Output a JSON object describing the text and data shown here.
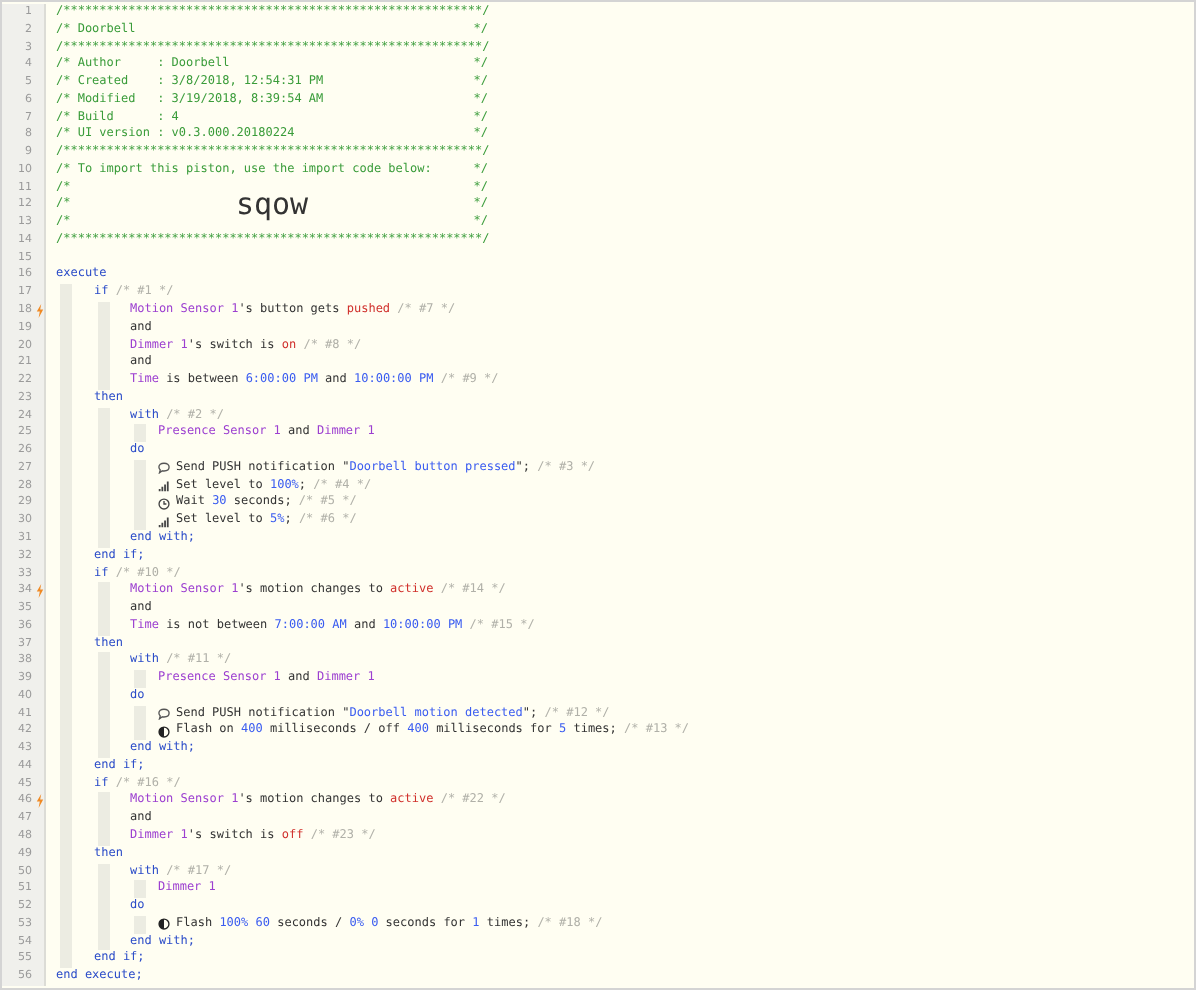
{
  "lines": [
    {
      "number": "1",
      "kind": "rule",
      "trigger": false,
      "segments": [
        {
          "kind": "comment",
          "text": "/**********************************************************/"
        }
      ]
    },
    {
      "number": "2",
      "kind": "framed",
      "trigger": false,
      "segments": [
        {
          "kind": "comment",
          "text": "/* Doorbell"
        },
        {
          "kind": "comment",
          "text": "*/"
        }
      ]
    },
    {
      "number": "3",
      "kind": "rule",
      "trigger": false,
      "segments": [
        {
          "kind": "comment",
          "text": "/**********************************************************/"
        }
      ]
    },
    {
      "number": "4",
      "kind": "framed",
      "trigger": false,
      "segments": [
        {
          "kind": "comment",
          "text": "/* Author     : Doorbell"
        },
        {
          "kind": "comment",
          "text": "*/"
        }
      ]
    },
    {
      "number": "5",
      "kind": "framed",
      "trigger": false,
      "segments": [
        {
          "kind": "comment",
          "text": "/* Created    : 3/8/2018, 12:54:31 PM"
        },
        {
          "kind": "comment",
          "text": "*/"
        }
      ]
    },
    {
      "number": "6",
      "kind": "framed",
      "trigger": false,
      "segments": [
        {
          "kind": "comment",
          "text": "/* Modified   : 3/19/2018, 8:39:54 AM"
        },
        {
          "kind": "comment",
          "text": "*/"
        }
      ]
    },
    {
      "number": "7",
      "kind": "framed",
      "trigger": false,
      "segments": [
        {
          "kind": "comment",
          "text": "/* Build      : 4"
        },
        {
          "kind": "comment",
          "text": "*/"
        }
      ]
    },
    {
      "number": "8",
      "kind": "framed",
      "trigger": false,
      "segments": [
        {
          "kind": "comment",
          "text": "/* UI version : v0.3.000.20180224"
        },
        {
          "kind": "comment",
          "text": "*/"
        }
      ]
    },
    {
      "number": "9",
      "kind": "rule",
      "trigger": false,
      "segments": [
        {
          "kind": "comment",
          "text": "/**********************************************************/"
        }
      ]
    },
    {
      "number": "10",
      "kind": "framed",
      "trigger": false,
      "segments": [
        {
          "kind": "comment",
          "text": "/* To import this piston, use the import code below:"
        },
        {
          "kind": "comment",
          "text": "*/"
        }
      ]
    },
    {
      "number": "11",
      "kind": "framed",
      "trigger": false,
      "segments": [
        {
          "kind": "comment",
          "text": "/*"
        },
        {
          "kind": "comment",
          "text": "*/"
        }
      ]
    },
    {
      "number": "12",
      "kind": "framed",
      "trigger": false,
      "segments": [
        {
          "kind": "comment",
          "text": "/*"
        },
        {
          "kind": "banner",
          "text": "sqow"
        },
        {
          "kind": "comment",
          "text": "*/"
        }
      ]
    },
    {
      "number": "13",
      "kind": "framed",
      "trigger": false,
      "segments": [
        {
          "kind": "comment",
          "text": "/*"
        },
        {
          "kind": "comment",
          "text": "*/"
        }
      ]
    },
    {
      "number": "14",
      "kind": "rule",
      "trigger": false,
      "segments": [
        {
          "kind": "comment",
          "text": "/**********************************************************/"
        }
      ]
    },
    {
      "number": "15",
      "kind": "blank",
      "trigger": false
    },
    {
      "number": "16",
      "kind": "code",
      "trigger": false,
      "segments": [
        {
          "kind": "keyword",
          "text": "execute"
        }
      ],
      "children": [
        {
          "number": "17",
          "kind": "code",
          "trigger": false,
          "segments": [
            {
              "kind": "keyword",
              "text": "if"
            },
            {
              "kind": "note",
              "text": " /* #1 */"
            }
          ],
          "children": [
            {
              "number": "18",
              "kind": "code",
              "trigger": true,
              "segments": [
                {
                  "kind": "device",
                  "text": "Motion Sensor 1"
                },
                {
                  "kind": "plain",
                  "text": "'s button gets "
                },
                {
                  "kind": "state",
                  "text": "pushed"
                },
                {
                  "kind": "note",
                  "text": " /* #7 */"
                }
              ]
            },
            {
              "number": "19",
              "kind": "code",
              "trigger": false,
              "segments": [
                {
                  "kind": "plain",
                  "text": "and"
                }
              ]
            },
            {
              "number": "20",
              "kind": "code",
              "trigger": false,
              "segments": [
                {
                  "kind": "device",
                  "text": "Dimmer 1"
                },
                {
                  "kind": "plain",
                  "text": "'s switch is "
                },
                {
                  "kind": "state",
                  "text": "on"
                },
                {
                  "kind": "note",
                  "text": " /* #8 */"
                }
              ]
            },
            {
              "number": "21",
              "kind": "code",
              "trigger": false,
              "segments": [
                {
                  "kind": "plain",
                  "text": "and"
                }
              ]
            },
            {
              "number": "22",
              "kind": "code",
              "trigger": false,
              "segments": [
                {
                  "kind": "device",
                  "text": "Time"
                },
                {
                  "kind": "plain",
                  "text": " is between "
                },
                {
                  "kind": "value",
                  "text": "6:00:00 PM"
                },
                {
                  "kind": "plain",
                  "text": " and "
                },
                {
                  "kind": "value",
                  "text": "10:00:00 PM"
                },
                {
                  "kind": "note",
                  "text": " /* #9 */"
                }
              ]
            }
          ]
        },
        {
          "number": "23",
          "kind": "code",
          "trigger": false,
          "segments": [
            {
              "kind": "keyword",
              "text": "then"
            }
          ],
          "children": [
            {
              "number": "24",
              "kind": "code",
              "trigger": false,
              "segments": [
                {
                  "kind": "keyword",
                  "text": "with"
                },
                {
                  "kind": "note",
                  "text": " /* #2 */"
                }
              ],
              "children": [
                {
                  "number": "25",
                  "kind": "code",
                  "trigger": false,
                  "segments": [
                    {
                      "kind": "device",
                      "text": "Presence Sensor 1"
                    },
                    {
                      "kind": "plain",
                      "text": " and "
                    },
                    {
                      "kind": "device",
                      "text": "Dimmer 1"
                    }
                  ]
                }
              ]
            },
            {
              "number": "26",
              "kind": "code",
              "trigger": false,
              "segments": [
                {
                  "kind": "keyword",
                  "text": "do"
                }
              ],
              "children": [
                {
                  "number": "27",
                  "kind": "notify",
                  "trigger": false,
                  "segments": [
                    {
                      "kind": "plain",
                      "text": "Send PUSH notification \""
                    },
                    {
                      "kind": "value",
                      "text": "Doorbell button pressed"
                    },
                    {
                      "kind": "plain",
                      "text": "\";"
                    },
                    {
                      "kind": "note",
                      "text": " /* #3 */"
                    }
                  ]
                },
                {
                  "number": "28",
                  "kind": "level",
                  "trigger": false,
                  "segments": [
                    {
                      "kind": "plain",
                      "text": "Set level to "
                    },
                    {
                      "kind": "value",
                      "text": "100%"
                    },
                    {
                      "kind": "plain",
                      "text": ";"
                    },
                    {
                      "kind": "note",
                      "text": " /* #4 */"
                    }
                  ]
                },
                {
                  "number": "29",
                  "kind": "wait",
                  "trigger": false,
                  "segments": [
                    {
                      "kind": "plain",
                      "text": "Wait "
                    },
                    {
                      "kind": "value",
                      "text": "30"
                    },
                    {
                      "kind": "plain",
                      "text": " seconds;"
                    },
                    {
                      "kind": "note",
                      "text": " /* #5 */"
                    }
                  ]
                },
                {
                  "number": "30",
                  "kind": "level",
                  "trigger": false,
                  "segments": [
                    {
                      "kind": "plain",
                      "text": "Set level to "
                    },
                    {
                      "kind": "value",
                      "text": "5%"
                    },
                    {
                      "kind": "plain",
                      "text": ";"
                    },
                    {
                      "kind": "note",
                      "text": " /* #6 */"
                    }
                  ]
                }
              ]
            },
            {
              "number": "31",
              "kind": "code",
              "trigger": false,
              "segments": [
                {
                  "kind": "keyword",
                  "text": "end with;"
                }
              ]
            }
          ]
        },
        {
          "number": "32",
          "kind": "code",
          "trigger": false,
          "segments": [
            {
              "kind": "keyword",
              "text": "end if;"
            }
          ]
        },
        {
          "number": "33",
          "kind": "code",
          "trigger": false,
          "segments": [
            {
              "kind": "keyword",
              "text": "if"
            },
            {
              "kind": "note",
              "text": " /* #10 */"
            }
          ],
          "children": [
            {
              "number": "34",
              "kind": "code",
              "trigger": true,
              "segments": [
                {
                  "kind": "device",
                  "text": "Motion Sensor 1"
                },
                {
                  "kind": "plain",
                  "text": "'s motion changes to "
                },
                {
                  "kind": "state",
                  "text": "active"
                },
                {
                  "kind": "note",
                  "text": " /* #14 */"
                }
              ]
            },
            {
              "number": "35",
              "kind": "code",
              "trigger": false,
              "segments": [
                {
                  "kind": "plain",
                  "text": "and"
                }
              ]
            },
            {
              "number": "36",
              "kind": "code",
              "trigger": false,
              "segments": [
                {
                  "kind": "device",
                  "text": "Time"
                },
                {
                  "kind": "plain",
                  "text": " is not between "
                },
                {
                  "kind": "value",
                  "text": "7:00:00 AM"
                },
                {
                  "kind": "plain",
                  "text": " and "
                },
                {
                  "kind": "value",
                  "text": "10:00:00 PM"
                },
                {
                  "kind": "note",
                  "text": " /* #15 */"
                }
              ]
            }
          ]
        },
        {
          "number": "37",
          "kind": "code",
          "trigger": false,
          "segments": [
            {
              "kind": "keyword",
              "text": "then"
            }
          ],
          "children": [
            {
              "number": "38",
              "kind": "code",
              "trigger": false,
              "segments": [
                {
                  "kind": "keyword",
                  "text": "with"
                },
                {
                  "kind": "note",
                  "text": " /* #11 */"
                }
              ],
              "children": [
                {
                  "number": "39",
                  "kind": "code",
                  "trigger": false,
                  "segments": [
                    {
                      "kind": "device",
                      "text": "Presence Sensor 1"
                    },
                    {
                      "kind": "plain",
                      "text": " and "
                    },
                    {
                      "kind": "device",
                      "text": "Dimmer 1"
                    }
                  ]
                }
              ]
            },
            {
              "number": "40",
              "kind": "code",
              "trigger": false,
              "segments": [
                {
                  "kind": "keyword",
                  "text": "do"
                }
              ],
              "children": [
                {
                  "number": "41",
                  "kind": "notify",
                  "trigger": false,
                  "segments": [
                    {
                      "kind": "plain",
                      "text": "Send PUSH notification \""
                    },
                    {
                      "kind": "value",
                      "text": "Doorbell motion detected"
                    },
                    {
                      "kind": "plain",
                      "text": "\";"
                    },
                    {
                      "kind": "note",
                      "text": " /* #12 */"
                    }
                  ]
                },
                {
                  "number": "42",
                  "kind": "flash",
                  "trigger": false,
                  "segments": [
                    {
                      "kind": "plain",
                      "text": "Flash on "
                    },
                    {
                      "kind": "value",
                      "text": "400"
                    },
                    {
                      "kind": "plain",
                      "text": " milliseconds / off "
                    },
                    {
                      "kind": "value",
                      "text": "400"
                    },
                    {
                      "kind": "plain",
                      "text": " milliseconds for "
                    },
                    {
                      "kind": "value",
                      "text": "5"
                    },
                    {
                      "kind": "plain",
                      "text": " times;"
                    },
                    {
                      "kind": "note",
                      "text": " /* #13 */"
                    }
                  ]
                }
              ]
            },
            {
              "number": "43",
              "kind": "code",
              "trigger": false,
              "segments": [
                {
                  "kind": "keyword",
                  "text": "end with;"
                }
              ]
            }
          ]
        },
        {
          "number": "44",
          "kind": "code",
          "trigger": false,
          "segments": [
            {
              "kind": "keyword",
              "text": "end if;"
            }
          ]
        },
        {
          "number": "45",
          "kind": "code",
          "trigger": false,
          "segments": [
            {
              "kind": "keyword",
              "text": "if"
            },
            {
              "kind": "note",
              "text": " /* #16 */"
            }
          ],
          "children": [
            {
              "number": "46",
              "kind": "code",
              "trigger": true,
              "segments": [
                {
                  "kind": "device",
                  "text": "Motion Sensor 1"
                },
                {
                  "kind": "plain",
                  "text": "'s motion changes to "
                },
                {
                  "kind": "state",
                  "text": "active"
                },
                {
                  "kind": "note",
                  "text": " /* #22 */"
                }
              ]
            },
            {
              "number": "47",
              "kind": "code",
              "trigger": false,
              "segments": [
                {
                  "kind": "plain",
                  "text": "and"
                }
              ]
            },
            {
              "number": "48",
              "kind": "code",
              "trigger": false,
              "segments": [
                {
                  "kind": "device",
                  "text": "Dimmer 1"
                },
                {
                  "kind": "plain",
                  "text": "'s switch is "
                },
                {
                  "kind": "state",
                  "text": "off"
                },
                {
                  "kind": "note",
                  "text": " /* #23 */"
                }
              ]
            }
          ]
        },
        {
          "number": "49",
          "kind": "code",
          "trigger": false,
          "segments": [
            {
              "kind": "keyword",
              "text": "then"
            }
          ],
          "children": [
            {
              "number": "50",
              "kind": "code",
              "trigger": false,
              "segments": [
                {
                  "kind": "keyword",
                  "text": "with"
                },
                {
                  "kind": "note",
                  "text": " /* #17 */"
                }
              ],
              "children": [
                {
                  "number": "51",
                  "kind": "code",
                  "trigger": false,
                  "segments": [
                    {
                      "kind": "device",
                      "text": "Dimmer 1"
                    }
                  ]
                }
              ]
            },
            {
              "number": "52",
              "kind": "code",
              "trigger": false,
              "segments": [
                {
                  "kind": "keyword",
                  "text": "do"
                }
              ],
              "children": [
                {
                  "number": "53",
                  "kind": "flash",
                  "trigger": false,
                  "segments": [
                    {
                      "kind": "plain",
                      "text": "Flash "
                    },
                    {
                      "kind": "value",
                      "text": "100% 60"
                    },
                    {
                      "kind": "plain",
                      "text": " seconds / "
                    },
                    {
                      "kind": "value",
                      "text": "0% 0"
                    },
                    {
                      "kind": "plain",
                      "text": " seconds for "
                    },
                    {
                      "kind": "value",
                      "text": "1"
                    },
                    {
                      "kind": "plain",
                      "text": " times;"
                    },
                    {
                      "kind": "note",
                      "text": " /* #18 */"
                    }
                  ]
                }
              ]
            },
            {
              "number": "54",
              "kind": "code",
              "trigger": false,
              "segments": [
                {
                  "kind": "keyword",
                  "text": "end with;"
                }
              ]
            }
          ]
        },
        {
          "number": "55",
          "kind": "code",
          "trigger": false,
          "segments": [
            {
              "kind": "keyword",
              "text": "end if;"
            }
          ]
        }
      ]
    },
    {
      "number": "56",
      "kind": "code",
      "trigger": false,
      "segments": [
        {
          "kind": "keyword",
          "text": "end execute;"
        }
      ]
    }
  ]
}
